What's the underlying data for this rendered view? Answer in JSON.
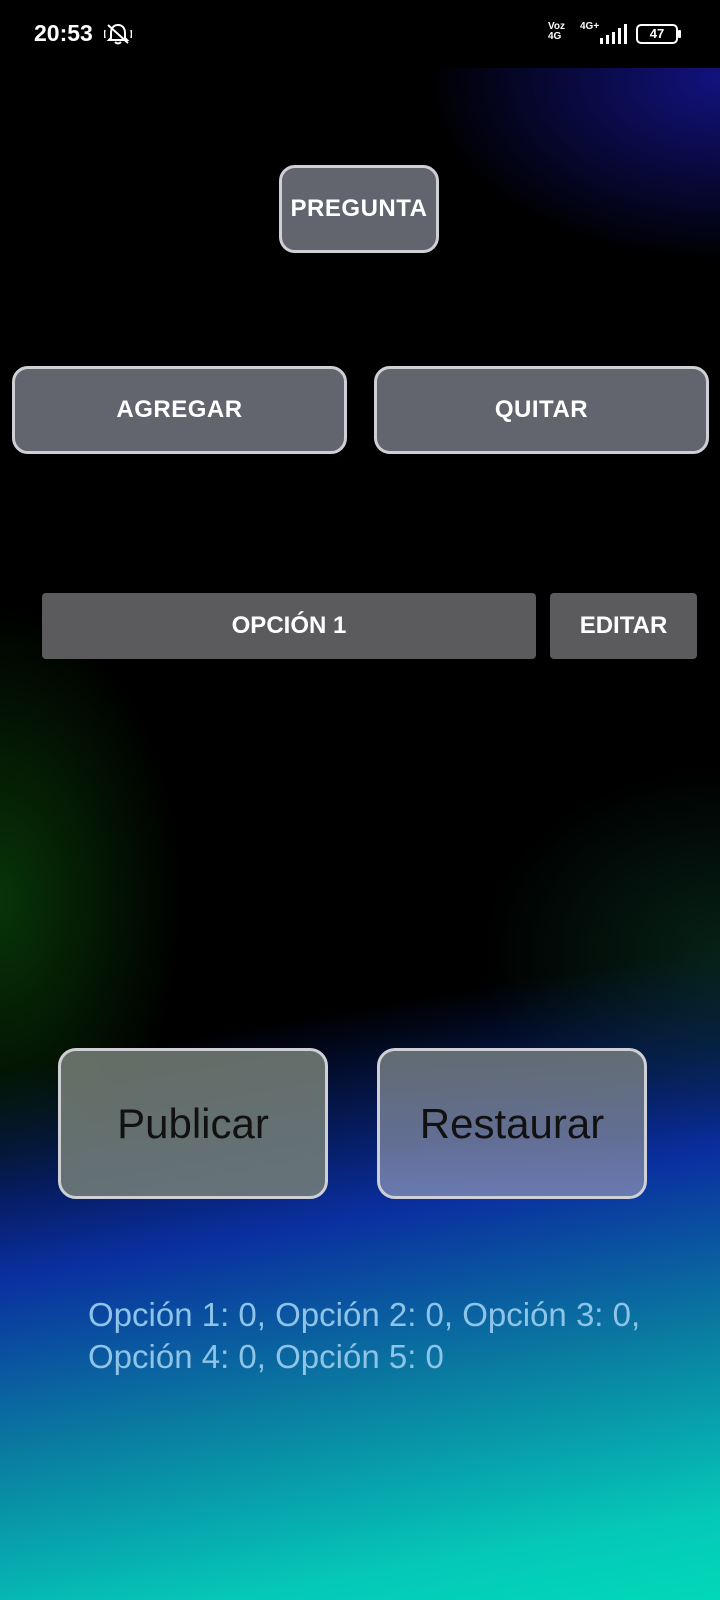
{
  "status_bar": {
    "time": "20:53",
    "network_left_top": "Voz",
    "network_left_bottom": "4G",
    "network_right_top": "4G+",
    "battery": "47"
  },
  "buttons": {
    "pregunta": "PREGUNTA",
    "agregar": "AGREGAR",
    "quitar": "QUITAR",
    "opcion": "OPCIÓN 1",
    "editar": "EDITAR",
    "publicar": "Publicar",
    "restaurar": "Restaurar"
  },
  "results": {
    "line1": "Opción 1: 0, Opción 2: 0, Opción 3: 0,",
    "line2": "Opción 4: 0, Opción 5: 0"
  }
}
